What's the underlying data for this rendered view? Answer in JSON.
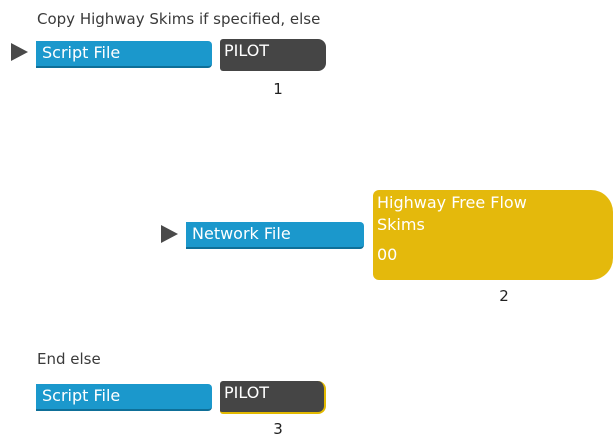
{
  "colors": {
    "file_box": "#1b98cc",
    "pilot_box": "#454545",
    "output_box": "#e4b90c",
    "arrow": "#4a4a4a",
    "text": "#3a3a3a"
  },
  "block1": {
    "caption": "Copy Highway Skims if specified, else",
    "input_label": "Script File",
    "program_label": "PILOT",
    "step_number": "1"
  },
  "block2": {
    "input_label": "Network File",
    "output_line1": "Highway Free Flow",
    "output_line2": "Skims",
    "output_code": "00",
    "step_number": "2"
  },
  "block3": {
    "caption": "End else",
    "input_label": "Script File",
    "program_label": "PILOT",
    "step_number": "3"
  }
}
